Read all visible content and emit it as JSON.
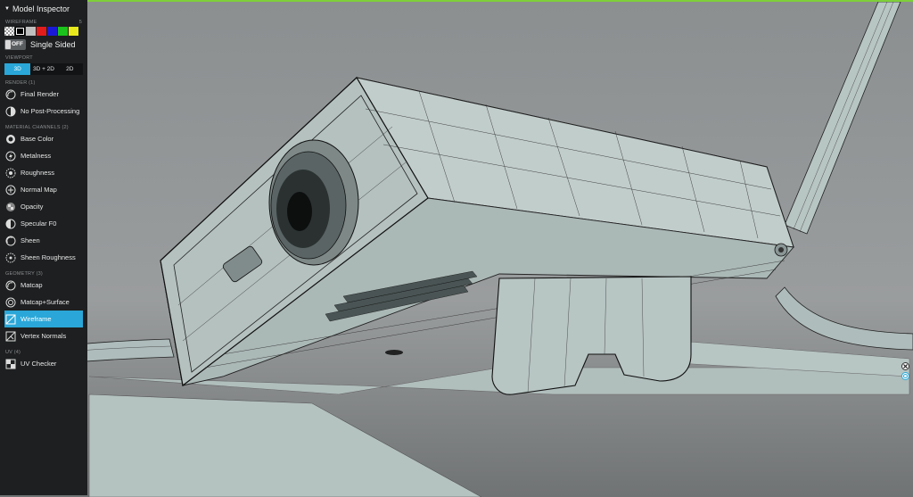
{
  "panel": {
    "title": "Model Inspector",
    "wireframe": {
      "section": "WIREFRAME",
      "value": "5",
      "swatches": [
        "#cfcfcf",
        "#000000",
        "#bfbfbf",
        "#e21b1b",
        "#1a1ad6",
        "#1cc31c",
        "#e8e81c"
      ]
    },
    "single_sided": {
      "toggle_text": "OFF",
      "label": "Single Sided"
    },
    "viewport": {
      "section": "VIEWPORT",
      "options": [
        "3D",
        "3D + 2D",
        "2D"
      ],
      "active": "3D"
    },
    "render": {
      "section": "RENDER (1)",
      "items": [
        "Final Render",
        "No Post-Processing"
      ]
    },
    "material": {
      "section": "MATERIAL CHANNELS (2)",
      "items": [
        "Base Color",
        "Metalness",
        "Roughness",
        "Normal Map",
        "Opacity",
        "Specular F0",
        "Sheen",
        "Sheen Roughness"
      ]
    },
    "geometry": {
      "section": "GEOMETRY (3)",
      "items": [
        "Matcap",
        "Matcap+Surface",
        "Wireframe",
        "Vertex Normals"
      ],
      "active": "Wireframe"
    },
    "uv": {
      "section": "UV (4)",
      "items": [
        "UV Checker"
      ]
    }
  },
  "colors": {
    "accent": "#2aa7d8",
    "panel_bg": "#1d1f20",
    "border": "#7fcf3a",
    "mesh": "#b9c6c4"
  }
}
